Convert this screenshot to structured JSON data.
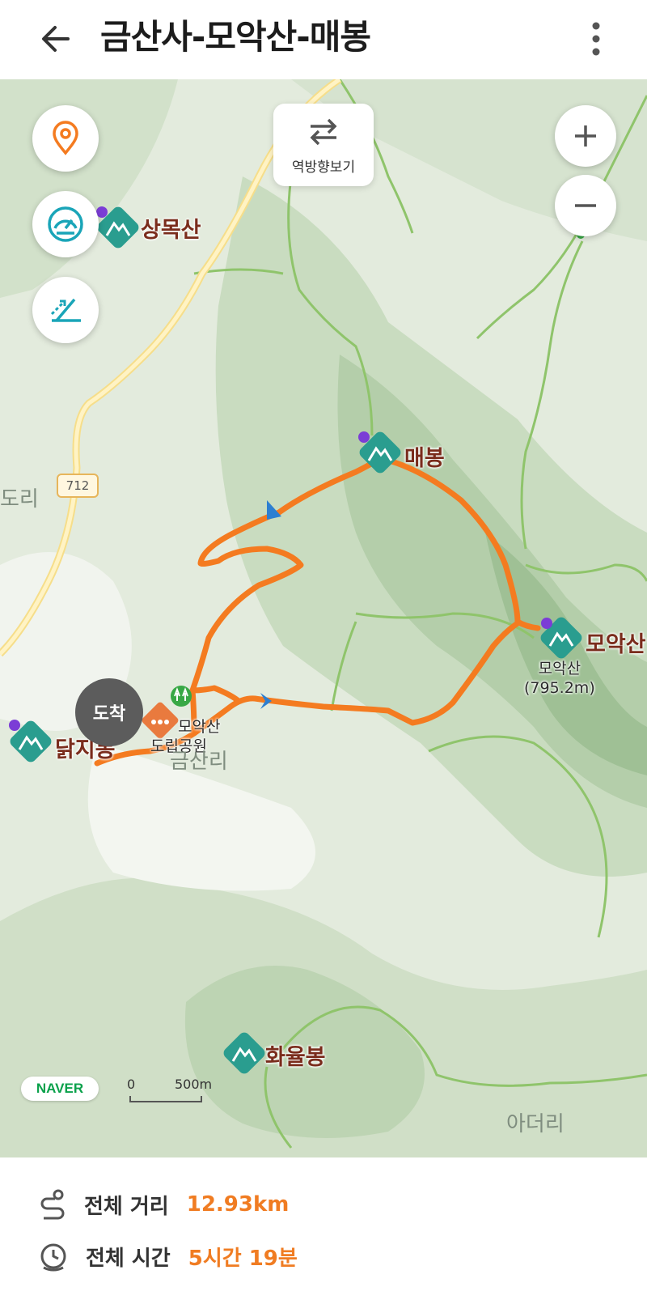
{
  "header": {
    "title": "금산사-모악산-매봉"
  },
  "map": {
    "reverse_label": "역방향보기",
    "road_number": "712",
    "arrive_label": "도착",
    "brand": "NAVER",
    "scale_zero": "0",
    "scale_max": "500m",
    "labels": {
      "sangmoksan": "상목산",
      "maebong": "매봉",
      "moaksan": "모악산",
      "moaksan_sub_name": "모악산",
      "moaksan_sub_height": "(795.2m)",
      "dakjibong": "닭지봉",
      "park_line1": "모악산",
      "park_line2": "도립공원",
      "village": "금산리",
      "hwayulbong": "화율봉",
      "left_village": "도리",
      "bottom_village": "아더리"
    },
    "colors": {
      "route": "#f47b20",
      "peak_icon": "#2a9d8f",
      "water": "#8fc46b"
    }
  },
  "summary": {
    "distance_label": "전체 거리",
    "distance_value": "12.93km",
    "time_label": "전체 시간",
    "time_value": "5시간 19분"
  }
}
